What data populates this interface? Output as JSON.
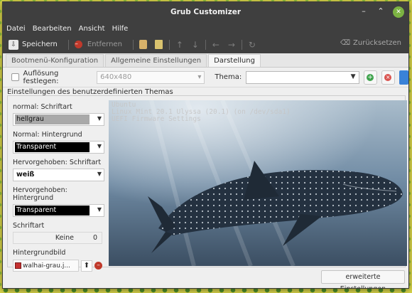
{
  "window": {
    "title": "Grub Customizer",
    "controls": [
      "–",
      "⌃",
      "✕"
    ]
  },
  "menu": [
    "Datei",
    "Bearbeiten",
    "Ansicht",
    "Hilfe"
  ],
  "toolbar": {
    "save": "Speichern",
    "remove": "Entfernen",
    "reset": "Zurücksetzen"
  },
  "tabs": [
    "Bootmenü-Konfiguration",
    "Allgemeine Einstellungen",
    "Darstellung"
  ],
  "resolution": {
    "label": "Auflösung festlegen:",
    "value": "640x480"
  },
  "theme": {
    "label": "Thema:",
    "value": ""
  },
  "custom_theme_group": "Einstellungen des benutzerdefinierten Themas",
  "settings": {
    "normal_font_label": "normal: Schriftart",
    "normal_font_value": "hellgrau",
    "normal_bg_label": "Normal: Hintergrund",
    "normal_bg_value": "Transparent",
    "highlight_font_label": "Hervorgehoben: Schriftart",
    "highlight_font_value": "weiß",
    "highlight_bg_label": "Hervorgehoben: Hintergrund",
    "highlight_bg_value": "Transparent",
    "font_label": "Schriftart",
    "font_name": "Keine",
    "font_size": "0",
    "bgimage_label": "Hintergrundbild",
    "bgimage_file": "walhai-grau.j..."
  },
  "preview_lines": [
    "Ubuntu",
    "Linux Mint 20.1 Ulyssa (20.1) (on /dev/sda1)",
    "UEFI Firmware Settings"
  ],
  "advanced_button": "erweiterte Einstellungen",
  "colors": {
    "titlebar": "#3f3f3f",
    "accent_green": "#7cb342",
    "water": "#6f8aa3"
  }
}
